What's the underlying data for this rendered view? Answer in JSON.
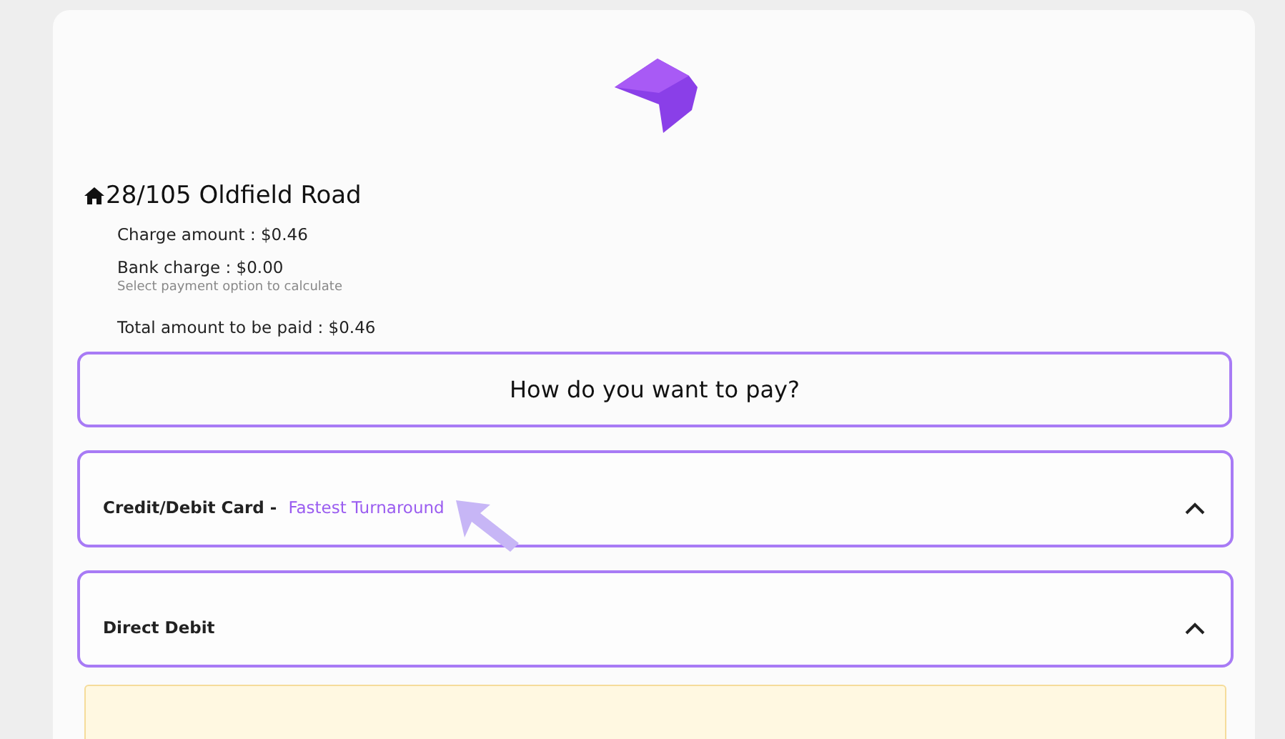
{
  "property": {
    "address": "28/105 Oldfield Road"
  },
  "charges": [
    {
      "label": "Charge amount : $0.46"
    },
    {
      "label": "Bank charge : $0.00",
      "hint": "Select payment option to calculate"
    },
    {
      "label": "Total amount to be paid : $0.46"
    }
  ],
  "question": "How do you want to pay?",
  "payment_options": [
    {
      "label": "Credit/Debit Card -",
      "tag": "Fastest Turnaround"
    },
    {
      "label": "Direct Debit"
    }
  ],
  "notice": {
    "kind": "warning"
  }
}
